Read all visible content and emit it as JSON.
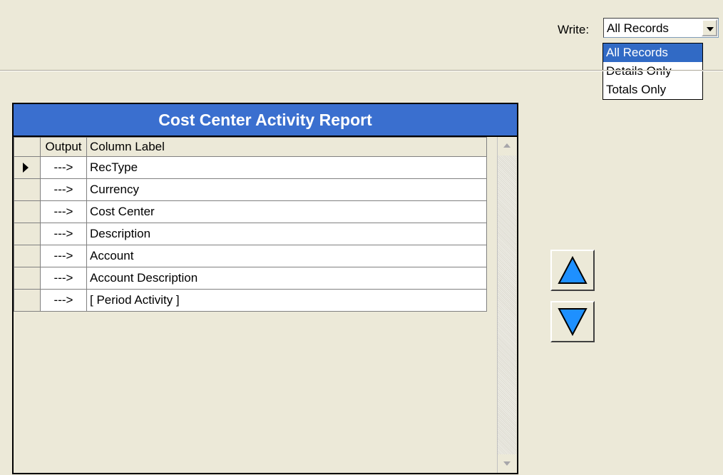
{
  "write": {
    "label": "Write:",
    "selected": "All Records",
    "options": [
      "All Records",
      "Details Only",
      "Totals Only"
    ]
  },
  "grid": {
    "title": "Cost Center Activity Report",
    "headers": {
      "output": "Output",
      "label": "Column Label"
    },
    "rows": [
      {
        "output": "--->",
        "label": "RecType"
      },
      {
        "output": "--->",
        "label": "Currency"
      },
      {
        "output": "--->",
        "label": "Cost Center"
      },
      {
        "output": "--->",
        "label": "Description"
      },
      {
        "output": "--->",
        "label": "Account"
      },
      {
        "output": "--->",
        "label": "Account Description"
      },
      {
        "output": "--->",
        "label": "[ Period Activity ]"
      }
    ],
    "selected_row_index": 0
  },
  "colors": {
    "title_bar": "#3a6fcf",
    "arrow_fill": "#1e90ff",
    "selection": "#316ac5"
  },
  "icons": {
    "move_up": "triangle-up-icon",
    "move_down": "triangle-down-icon",
    "current_row": "row-pointer-icon"
  }
}
